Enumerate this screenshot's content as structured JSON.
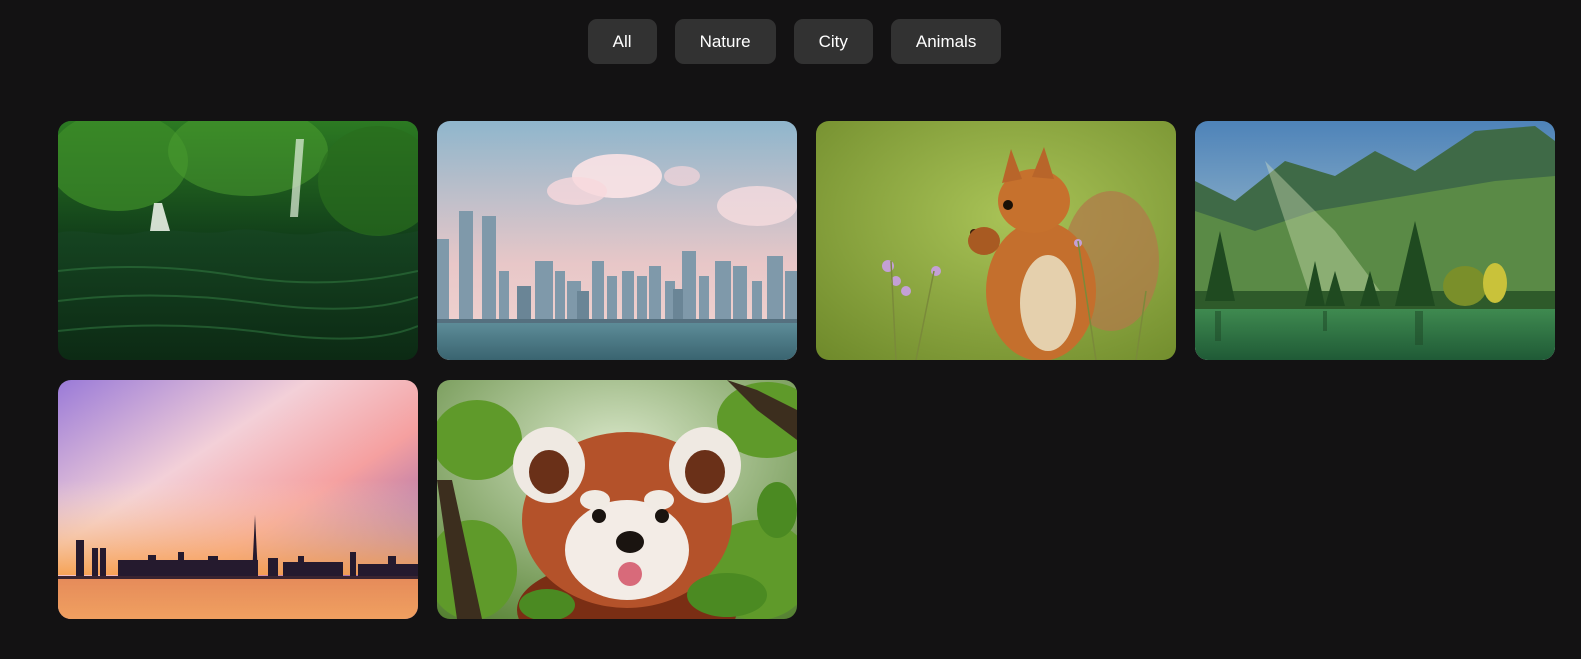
{
  "filters": [
    {
      "label": "All"
    },
    {
      "label": "Nature"
    },
    {
      "label": "City"
    },
    {
      "label": "Animals"
    }
  ],
  "gallery": [
    {
      "category": "nature",
      "subject": "waterfall"
    },
    {
      "category": "city",
      "subject": "skyline-day"
    },
    {
      "category": "animals",
      "subject": "squirrel"
    },
    {
      "category": "nature",
      "subject": "mountain-lake"
    },
    {
      "category": "city",
      "subject": "skyline-sunset"
    },
    {
      "category": "animals",
      "subject": "red-panda"
    }
  ],
  "colors": {
    "background": "#131213",
    "button_bg": "#323232",
    "button_text": "#ffffff"
  }
}
